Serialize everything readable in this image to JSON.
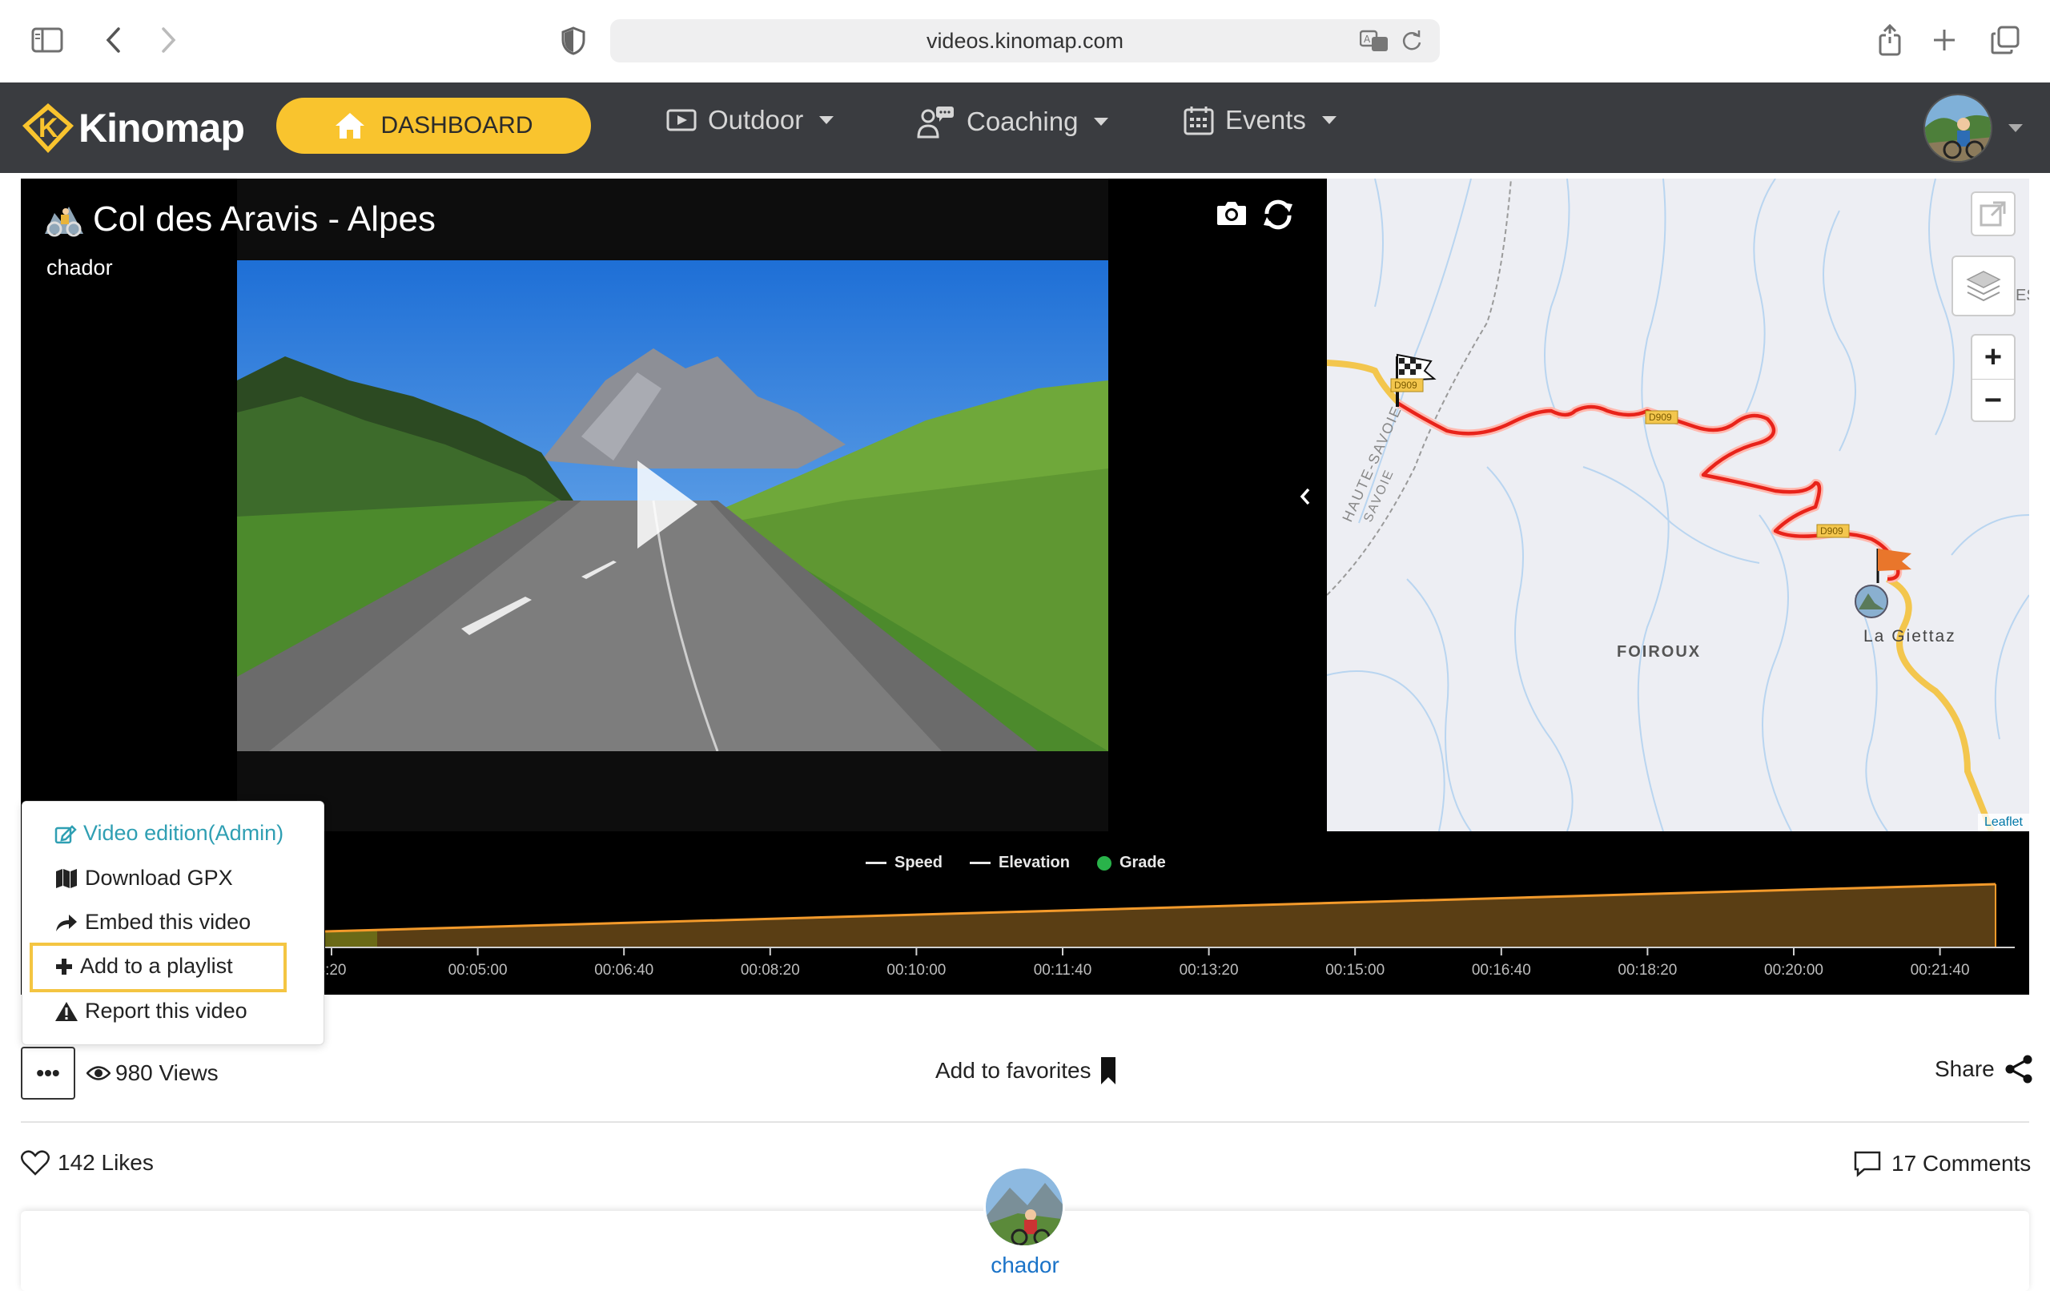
{
  "browser": {
    "url": "videos.kinomap.com"
  },
  "nav": {
    "brand": "Kinomap",
    "dashboard": "DASHBOARD",
    "items": [
      {
        "label": "Outdoor"
      },
      {
        "label": "Coaching"
      },
      {
        "label": "Events"
      }
    ]
  },
  "video": {
    "title": "Col des Aravis - Alpes",
    "author": "chador"
  },
  "map": {
    "labels": [
      "FOIROUX",
      "La Giettaz",
      "HAUTE-SAVOIE",
      "SAVOIE"
    ],
    "road_labels": [
      "D909",
      "D909",
      "D909"
    ],
    "attribution": "Leaflet"
  },
  "chart_data": {
    "type": "area",
    "legend": [
      "Speed",
      "Elevation",
      "Grade"
    ],
    "x_ticks": [
      "3:20",
      "00:05:00",
      "00:06:40",
      "00:08:20",
      "00:10:00",
      "00:11:40",
      "00:13:20",
      "00:15:00",
      "00:16:40",
      "00:18:20",
      "00:20:00",
      "00:21:40"
    ]
  },
  "menu": {
    "items": [
      {
        "label": "Video edition(Admin)"
      },
      {
        "label": "Download GPX"
      },
      {
        "label": "Embed this video"
      },
      {
        "label": "Add to a playlist"
      },
      {
        "label": "Report this video"
      }
    ]
  },
  "stats": {
    "more": "•••",
    "views": "980 Views",
    "favorites": "Add to favorites",
    "share": "Share",
    "likes": "142 Likes",
    "comments": "17 Comments"
  },
  "author_card": {
    "name": "chador"
  },
  "colors": {
    "nav_bg": "#3a3c40",
    "dashboard_yellow": "#f9c42e",
    "route_red": "#e8231a",
    "highlight": "#f4c542",
    "link_blue": "#1a73c8"
  }
}
